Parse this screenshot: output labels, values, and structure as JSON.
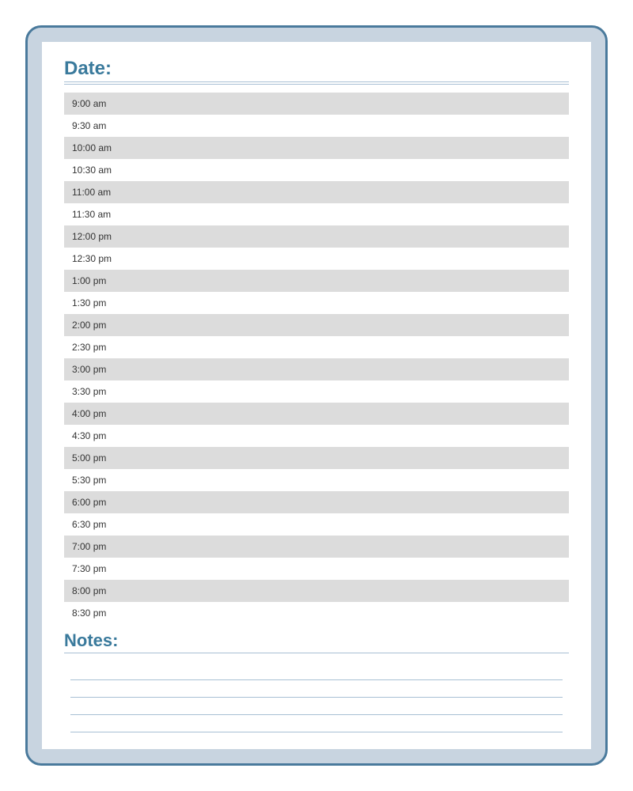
{
  "header": {
    "date_label": "Date:",
    "notes_label": "Notes:"
  },
  "schedule": {
    "slots": [
      "9:00 am",
      "9:30 am",
      "10:00 am",
      "10:30 am",
      "11:00 am",
      "11:30 am",
      "12:00 pm",
      "12:30 pm",
      "1:00 pm",
      "1:30 pm",
      "2:00 pm",
      "2:30 pm",
      "3:00 pm",
      "3:30 pm",
      "4:00 pm",
      "4:30 pm",
      "5:00 pm",
      "5:30 pm",
      "6:00 pm",
      "6:30 pm",
      "7:00 pm",
      "7:30 pm",
      "8:00 pm",
      "8:30 pm"
    ]
  },
  "notes": {
    "line_count": 4
  }
}
